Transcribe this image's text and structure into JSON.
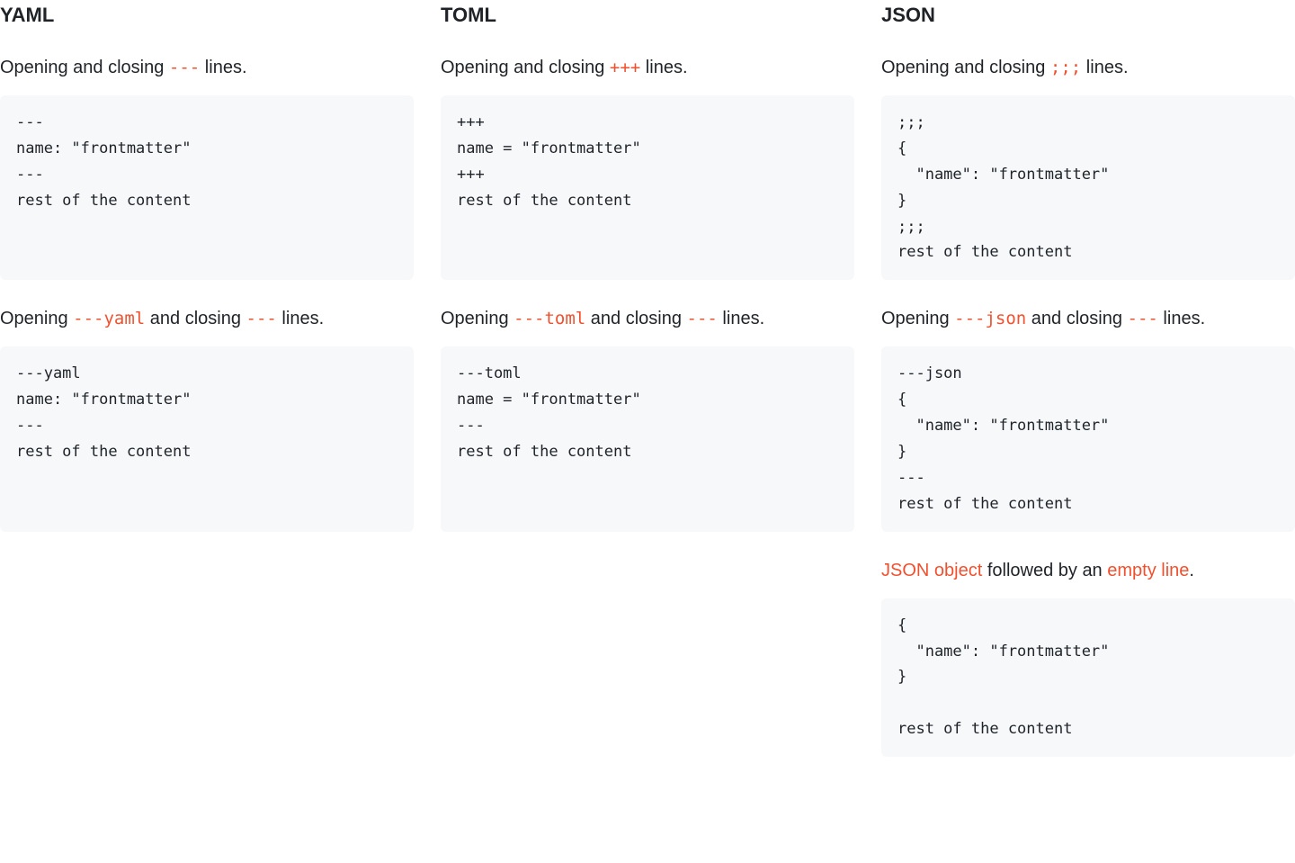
{
  "columns": {
    "yaml": {
      "heading": "YAML",
      "block1": {
        "desc_pre": "Opening and closing ",
        "desc_code": "---",
        "desc_post": " lines.",
        "code": "---\nname: \"frontmatter\"\n---\nrest of the content\n\n "
      },
      "block2": {
        "desc_pre": "Opening ",
        "desc_code1": "---yaml",
        "desc_mid": " and closing ",
        "desc_code2": "---",
        "desc_post": " lines.",
        "code": "---yaml\nname: \"frontmatter\"\n---\nrest of the content\n\n "
      }
    },
    "toml": {
      "heading": "TOML",
      "block1": {
        "desc_pre": "Opening and closing ",
        "desc_code": "+++",
        "desc_post": " lines.",
        "code": "+++\nname = \"frontmatter\"\n+++\nrest of the content\n\n "
      },
      "block2": {
        "desc_pre": "Opening ",
        "desc_code1": "---toml",
        "desc_mid": " and closing ",
        "desc_code2": "---",
        "desc_post": " lines.",
        "code": "---toml\nname = \"frontmatter\"\n---\nrest of the content\n\n "
      }
    },
    "json": {
      "heading": "JSON",
      "block1": {
        "desc_pre": "Opening and closing ",
        "desc_code": ";;;",
        "desc_post": " lines.",
        "code": ";;;\n{\n  \"name\": \"frontmatter\"\n}\n;;;\nrest of the content"
      },
      "block2": {
        "desc_pre": "Opening ",
        "desc_code1": "---json",
        "desc_mid": " and closing ",
        "desc_code2": "---",
        "desc_post": " lines.",
        "code": "---json\n{\n  \"name\": \"frontmatter\"\n}\n---\nrest of the content"
      },
      "block3": {
        "desc_link1": "JSON object",
        "desc_mid": " followed by an ",
        "desc_link2": "empty line",
        "desc_post": ".",
        "code": "{\n  \"name\": \"frontmatter\"\n}\n\nrest of the content"
      }
    }
  }
}
